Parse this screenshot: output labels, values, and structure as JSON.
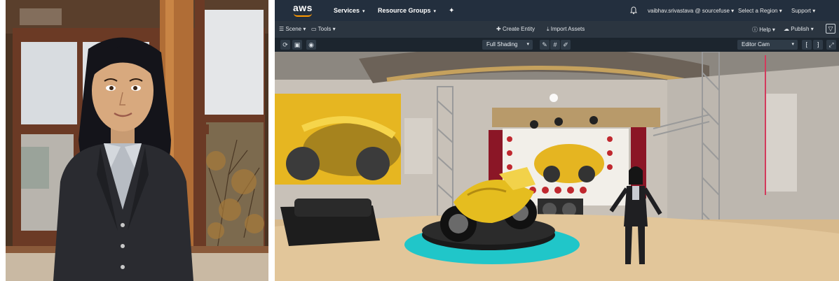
{
  "topnav": {
    "logo_text": "aws",
    "services_label": "Services",
    "resource_groups_label": "Resource Groups",
    "account_label": "vaibhav.srivastava @ sourcefuse",
    "region_label": "Select a Region",
    "support_label": "Support"
  },
  "menubar": {
    "scene_label": "Scene",
    "tools_label": "Tools",
    "create_entity_label": "Create Entity",
    "import_assets_label": "Import Assets",
    "help_label": "Help",
    "publish_label": "Publish"
  },
  "toolbar": {
    "shading_value": "Full Shading",
    "camera_value": "Editor Cam"
  },
  "icons": {
    "bell": "bell-icon",
    "pin": "pin-icon",
    "plus": "plus-icon",
    "import": "import-icon",
    "help": "help-icon",
    "publish": "cloud-icon"
  },
  "colors": {
    "nav_bg": "#232f3e",
    "brand_orange": "#ff9900",
    "menubar_bg": "#2b3540",
    "toolbar_bg": "#1c252e"
  }
}
